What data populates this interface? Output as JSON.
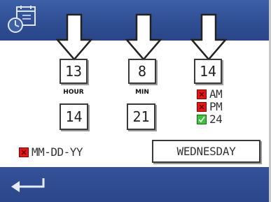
{
  "header": {
    "icon": "calendar-clock-icon"
  },
  "date_fields": {
    "first": "13",
    "second": "8",
    "third": "14"
  },
  "time_fields": {
    "hour": {
      "label": "HOUR",
      "value": "14"
    },
    "min": {
      "label": "MIN",
      "value": "21"
    }
  },
  "time_format": {
    "am": {
      "label": "AM",
      "checked": false
    },
    "pm": {
      "label": "PM",
      "checked": false
    },
    "h24": {
      "label": "24",
      "checked": true
    }
  },
  "date_format": {
    "label": "MM-DD-YY",
    "checked": false
  },
  "weekday": "WEDNESDAY",
  "footer": {
    "icon": "back-arrow-icon"
  },
  "colors": {
    "header_blue": "#2f4d92",
    "unchecked_red": "#e01818",
    "checked_green": "#3cc23c"
  }
}
